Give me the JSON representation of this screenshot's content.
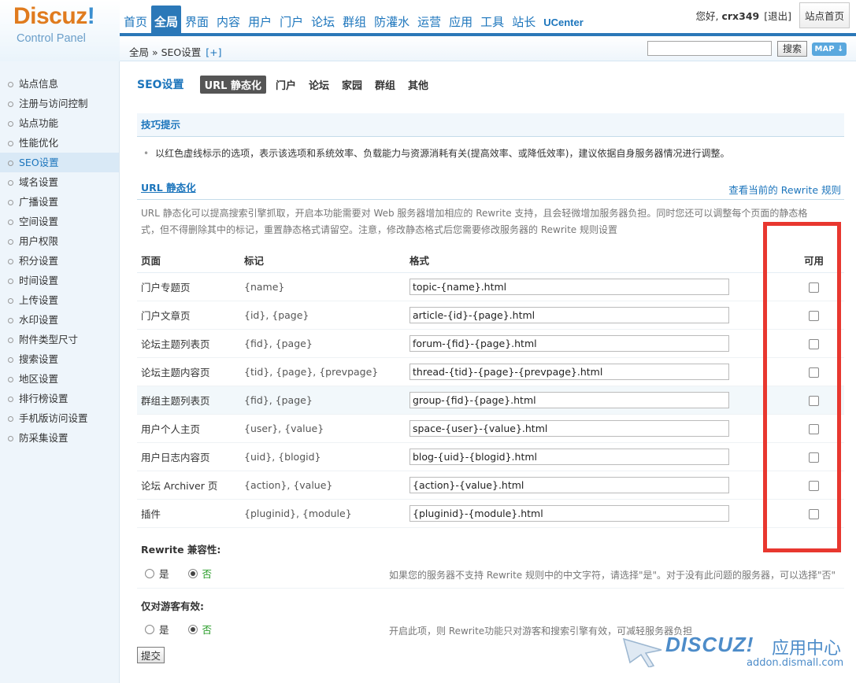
{
  "logo": {
    "brand": "Discuz",
    "bang": "!",
    "sub": "Control Panel"
  },
  "nav": {
    "items": [
      "首页",
      "全局",
      "界面",
      "内容",
      "用户",
      "门户",
      "论坛",
      "群组",
      "防灌水",
      "运营",
      "应用",
      "工具",
      "站长",
      "UCenter"
    ],
    "active_index": 1
  },
  "user": {
    "greeting": "您好,",
    "name": "crx349",
    "logout": "[退出]",
    "home": "站点首页"
  },
  "subbar": {
    "crumb": "全局 » SEO设置",
    "plus": "[+]",
    "search_button": "搜索",
    "map_button": "MAP ↓"
  },
  "sidebar": {
    "items": [
      "站点信息",
      "注册与访问控制",
      "站点功能",
      "性能优化",
      "SEO设置",
      "域名设置",
      "广播设置",
      "空间设置",
      "用户权限",
      "积分设置",
      "时间设置",
      "上传设置",
      "水印设置",
      "附件类型尺寸",
      "搜索设置",
      "地区设置",
      "排行榜设置",
      "手机版访问设置",
      "防采集设置"
    ],
    "active_index": 4
  },
  "tabs": {
    "title": "SEO设置",
    "items": [
      "URL 静态化",
      "门户",
      "论坛",
      "家园",
      "群组",
      "其他"
    ],
    "active_index": 0
  },
  "tips": {
    "heading": "技巧提示",
    "text": "以红色虚线标示的选项，表示该选项和系统效率、负载能力与资源消耗有关(提高效率、或降低效率)，建议依据自身服务器情况进行调整。"
  },
  "url_section": {
    "heading": "URL 静态化",
    "view_link": "查看当前的 Rewrite 规则",
    "desc": "URL 静态化可以提高搜索引擎抓取，开启本功能需要对 Web 服务器增加相应的 Rewrite 支持，且会轻微增加服务器负担。同时您还可以调整每个页面的静态格式，但不得删除其中的标记，重置静态格式请留空。注意，修改静态格式后您需要修改服务器的 Rewrite 规则设置"
  },
  "rules": {
    "headers": {
      "page": "页面",
      "mark": "标记",
      "format": "格式",
      "enabled": "可用"
    },
    "rows": [
      {
        "page": "门户专题页",
        "mark": "{name}",
        "format": "topic-{name}.html",
        "enabled": false
      },
      {
        "page": "门户文章页",
        "mark": "{id}, {page}",
        "format": "article-{id}-{page}.html",
        "enabled": false
      },
      {
        "page": "论坛主题列表页",
        "mark": "{fid}, {page}",
        "format": "forum-{fid}-{page}.html",
        "enabled": false
      },
      {
        "page": "论坛主题内容页",
        "mark": "{tid}, {page}, {prevpage}",
        "format": "thread-{tid}-{page}-{prevpage}.html",
        "enabled": false
      },
      {
        "page": "群组主题列表页",
        "mark": "{fid}, {page}",
        "format": "group-{fid}-{page}.html",
        "enabled": false
      },
      {
        "page": "用户个人主页",
        "mark": "{user}, {value}",
        "format": "space-{user}-{value}.html",
        "enabled": false
      },
      {
        "page": "用户日志内容页",
        "mark": "{uid}, {blogid}",
        "format": "blog-{uid}-{blogid}.html",
        "enabled": false
      },
      {
        "page": "论坛 Archiver 页",
        "mark": "{action}, {value}",
        "format": "{action}-{value}.html",
        "enabled": false
      },
      {
        "page": "插件",
        "mark": "{pluginid}, {module}",
        "format": "{pluginid}-{module}.html",
        "enabled": false
      }
    ],
    "highlighted_row": 4,
    "highlight_color": "#e8372f"
  },
  "rewrite_compat": {
    "title": "Rewrite 兼容性:",
    "yes": "是",
    "no": "否",
    "selected": "no",
    "desc": "如果您的服务器不支持 Rewrite 规则中的中文字符，请选择\"是\"。对于没有此问题的服务器，可以选择\"否\""
  },
  "guest_only": {
    "title": "仅对游客有效:",
    "yes": "是",
    "no": "否",
    "selected": "no",
    "desc": "开启此项，则 Rewrite功能只对游客和搜索引擎有效，可减轻服务器负担"
  },
  "submit": "提交",
  "watermark": {
    "title": "DISCUZ!",
    "cn": "应用中心",
    "url": "addon.dismall.com"
  }
}
